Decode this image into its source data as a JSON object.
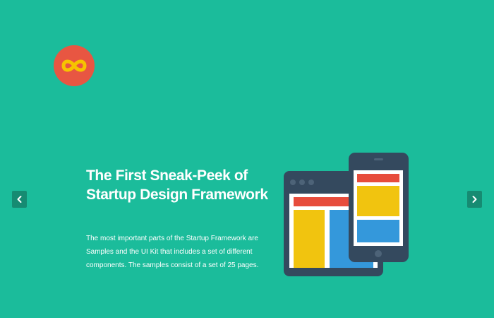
{
  "logo": {
    "icon": "infinity-icon",
    "color": "#e85642",
    "glyph_color": "#f6c400"
  },
  "slider": {
    "prev_icon": "chevron-left-icon",
    "next_icon": "chevron-right-icon"
  },
  "hero": {
    "title": "The First Sneak-Peek of Startup Design Framework",
    "description": "The most important parts of the Startup Framework are Samples and the UI Kit that includes a set of different components. The samples consist of a set of 25 pages."
  },
  "illustration": {
    "icon": "responsive-devices-icon"
  },
  "colors": {
    "background": "#1bbc9b",
    "device_frame": "#34495e",
    "red": "#e74c3c",
    "yellow": "#f1c40f",
    "blue": "#3498db"
  }
}
